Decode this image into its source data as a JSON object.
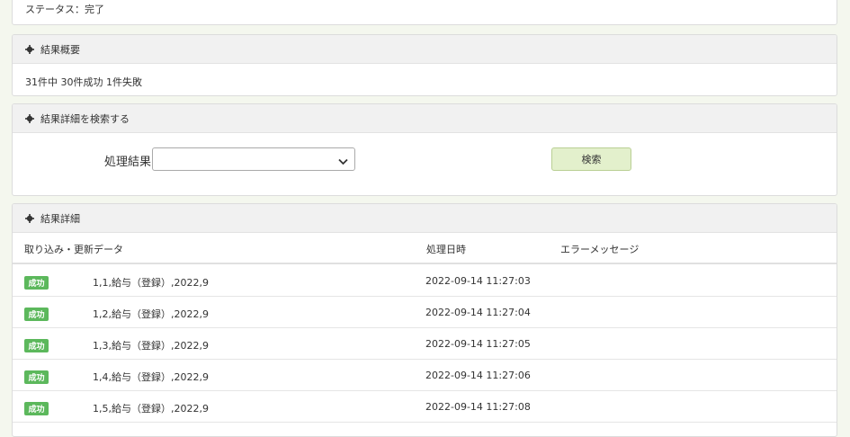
{
  "status_panel": {
    "text": "ステータス：完了"
  },
  "summary_panel": {
    "title": "結果概要",
    "text": "31件中 30件成功 1件失敗"
  },
  "search_panel": {
    "title": "結果詳細を検索する",
    "label": "処理結果",
    "select_value": "",
    "button_label": "検索"
  },
  "detail_panel": {
    "title": "結果詳細",
    "columns": [
      "取り込み・更新データ",
      "処理日時",
      "エラーメッセージ"
    ],
    "rows": [
      {
        "badge": "成功",
        "data": "1,1,給与（登録）,2022,9",
        "date": "2022-09-14 11:27:03",
        "error": ""
      },
      {
        "badge": "成功",
        "data": "1,2,給与（登録）,2022,9",
        "date": "2022-09-14 11:27:04",
        "error": ""
      },
      {
        "badge": "成功",
        "data": "1,3,給与（登録）,2022,9",
        "date": "2022-09-14 11:27:05",
        "error": ""
      },
      {
        "badge": "成功",
        "data": "1,4,給与（登録）,2022,9",
        "date": "2022-09-14 11:27:06",
        "error": ""
      },
      {
        "badge": "成功",
        "data": "1,5,給与（登録）,2022,9",
        "date": "2022-09-14 11:27:08",
        "error": ""
      }
    ]
  },
  "colors": {
    "success_badge": "#5cb85c",
    "search_button_bg": "#e3f0cc",
    "page_bg": "#f4f7ee"
  },
  "icons": {
    "panel_heading": "gear-icon",
    "select": "chevron-down-icon"
  }
}
